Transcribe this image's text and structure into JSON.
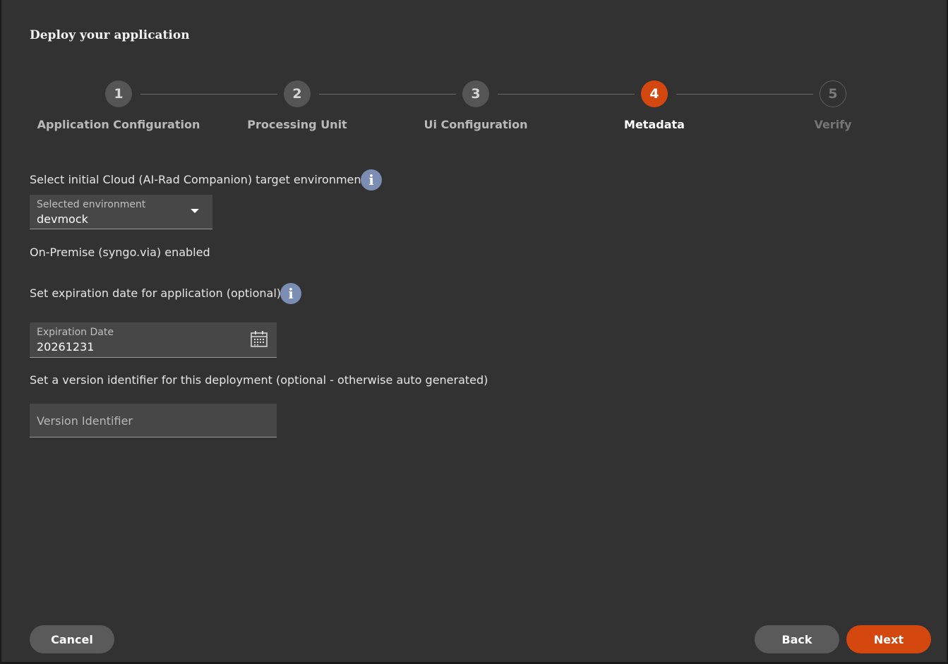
{
  "dialog": {
    "title": "Deploy your application"
  },
  "stepper": {
    "steps": [
      {
        "number": "1",
        "label": "Application Configuration",
        "state": "done"
      },
      {
        "number": "2",
        "label": "Processing Unit",
        "state": "done"
      },
      {
        "number": "3",
        "label": "Ui Configuration",
        "state": "done"
      },
      {
        "number": "4",
        "label": "Metadata",
        "state": "active"
      },
      {
        "number": "5",
        "label": "Verify",
        "state": "todo"
      }
    ]
  },
  "environment": {
    "prompt": "Select initial Cloud (AI-Rad Companion) target environment",
    "info_icon": "i",
    "select_label": "Selected environment",
    "selected_value": "devmock"
  },
  "on_premise": {
    "text": "On-Premise (syngo.via) enabled"
  },
  "expiration": {
    "prompt": "Set expiration date for application (optional)",
    "info_icon": "i",
    "field_label": "Expiration Date",
    "value": "20261231",
    "icon": "calendar-icon"
  },
  "version": {
    "prompt": "Set a version identifier for this deployment (optional - otherwise auto generated)",
    "placeholder": "Version Identifier",
    "value": ""
  },
  "footer": {
    "cancel_label": "Cancel",
    "back_label": "Back",
    "next_label": "Next"
  },
  "colors": {
    "accent": "#d4470f",
    "background": "#323232",
    "info": "#7b8db3"
  }
}
